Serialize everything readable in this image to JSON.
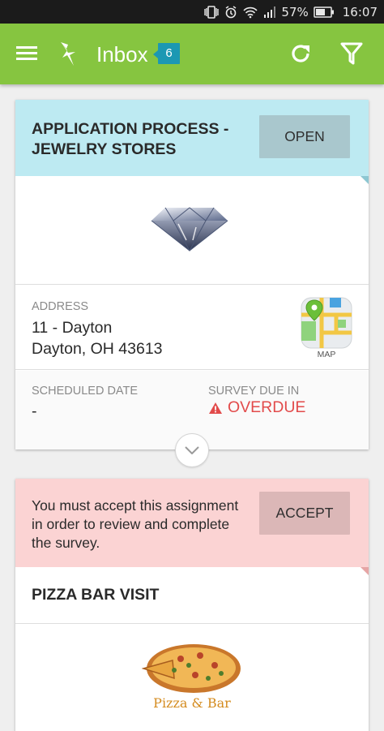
{
  "status_bar": {
    "battery": "57%",
    "time": "16:07",
    "icons": [
      "vibrate-icon",
      "alarm-icon",
      "wifi-icon",
      "signal-icon",
      "battery-icon"
    ]
  },
  "app_bar": {
    "title": "Inbox",
    "badge": "6",
    "icons": [
      "menu-icon",
      "app-logo-icon",
      "refresh-icon",
      "filter-icon"
    ],
    "color": "#86c540"
  },
  "cards": [
    {
      "title": "APPLICATION PROCESS - JEWELRY STORES",
      "button": "OPEN",
      "header_color": "#bdeaf2",
      "image_icon": "diamond-icon",
      "address_label": "ADDRESS",
      "address_line1": "11 - Dayton",
      "address_line2": "Dayton, OH 43613",
      "map_label": "MAP",
      "scheduled_label": "SCHEDULED DATE",
      "scheduled_value": "-",
      "due_label": "SURVEY DUE IN",
      "due_value": "OVERDUE",
      "due_color": "#e24b4b"
    },
    {
      "message": "You must accept this assignment in order to review and complete the survey.",
      "button": "ACCEPT",
      "header_color": "#fbd3d3",
      "title": "PIZZA BAR VISIT",
      "logo_text": "Pizza & Bar"
    }
  ]
}
